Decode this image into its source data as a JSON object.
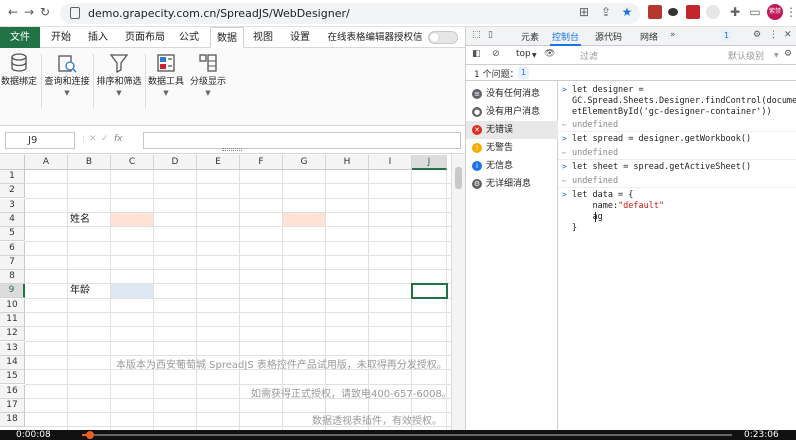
{
  "browser": {
    "url": "demo.grapecity.com.cn/SpreadJS/WebDesigner/",
    "avatar_label": "紫禁"
  },
  "ribbon": {
    "tabs": [
      "文件",
      "开始",
      "插入",
      "页面布局",
      "公式",
      "数据",
      "视图",
      "设置",
      "在线表格编辑器授权信息"
    ],
    "active_tab": "数据",
    "buttons": [
      "数据绑定",
      "查询和连接",
      "排序和筛选",
      "数据工具",
      "分级显示"
    ]
  },
  "formula_bar": {
    "name_box": "J9",
    "fx_label": "fx",
    "value": ""
  },
  "sheet": {
    "columns": [
      "A",
      "B",
      "C",
      "D",
      "E",
      "F",
      "G",
      "H",
      "I",
      "J"
    ],
    "selected_column": "J",
    "rows": [
      "1",
      "2",
      "3",
      "4",
      "5",
      "6",
      "7",
      "8",
      "9",
      "10",
      "11",
      "12",
      "13",
      "14",
      "15",
      "16",
      "17",
      "18"
    ],
    "selected_row": "9",
    "cells": {
      "B4": "姓名",
      "B9": "年龄"
    },
    "highlight_colors": {
      "name_fill": "#fde3d6",
      "age_fill": "#dde8f5"
    },
    "watermark": [
      "本版本为西安葡萄城 SpreadJS 表格控件产品试用版，未取得再分发授权。",
      "如需获得正式授权，请致电400-657-6008。",
      "数据透视表插件，有效授权。"
    ]
  },
  "devtools": {
    "tabs": [
      "元素",
      "控制台",
      "源代码",
      "网络"
    ],
    "active_tab": "控制台",
    "tabs_badge": "1",
    "context": "top",
    "filter_placeholder": "过滤",
    "level": "默认级别",
    "issues_label": "1 个问题：",
    "issues_badge": "1",
    "sidebar": [
      {
        "label": "没有任何消息",
        "icon": "list-icon"
      },
      {
        "label": "没有用户消息",
        "icon": "user-icon"
      },
      {
        "label": "无错误",
        "icon": "error-icon"
      },
      {
        "label": "无警告",
        "icon": "warning-icon"
      },
      {
        "label": "无信息",
        "icon": "info-icon"
      },
      {
        "label": "无详细消息",
        "icon": "gear-icon"
      }
    ],
    "sidebar_selected": "无错误",
    "console_lines": [
      "let designer =",
      "GC.Spread.Sheets.Designer.findControl(document.g",
      "etElementById('gc-designer-container'))",
      "undefined",
      "let spread = designer.getWorkbook()",
      "undefined",
      "let sheet = spread.getActiveSheet()",
      "undefined",
      "let data = {",
      "    name:",
      "\"default\"",
      "    ag",
      "}"
    ]
  },
  "video": {
    "current_time": "0:00:08",
    "duration": "0:23:06",
    "progress": 0.013
  },
  "colors": {
    "excel_green": "#217346",
    "devtools_blue": "#1a73e8",
    "progress_orange": "#e85d2a"
  }
}
